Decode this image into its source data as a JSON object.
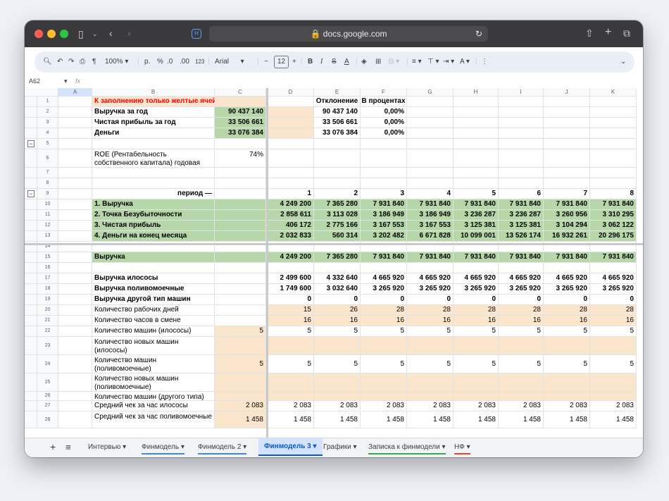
{
  "browser": {
    "url": "docs.google.com",
    "shield": "H"
  },
  "toolbar": {
    "zoom": "100%",
    "font": "Arial",
    "font_size": "12",
    "currency": "р.",
    "percent": "%",
    "dec_less": ".0",
    "dec_more": ".00",
    "number_format": "123"
  },
  "formula": {
    "cell_ref": "A62",
    "fx": "fx",
    "value": ""
  },
  "columns": [
    "A",
    "B",
    "C",
    "D",
    "E",
    "F",
    "G",
    "H",
    "I",
    "J",
    "K"
  ],
  "rows": [
    {
      "n": "1",
      "B": "К заполнению только желтые ячейки!",
      "E": "Отклонение",
      "F": "В процентах"
    },
    {
      "n": "2",
      "B": "Выручка за год",
      "C": "90 437 140",
      "E": "90 437 140",
      "F": "0,00%"
    },
    {
      "n": "3",
      "B": "Чистая прибыль за год",
      "C": "33 506 661",
      "E": "33 506 661",
      "F": "0,00%"
    },
    {
      "n": "4",
      "B": "Деньги",
      "C": "33 076 384",
      "E": "33 076 384",
      "F": "0,00%"
    },
    {
      "n": "5"
    },
    {
      "n": "6",
      "B": "ROE (Рентабельность собственного капитала) годовая",
      "C": "74%"
    },
    {
      "n": "7"
    },
    {
      "n": "8"
    },
    {
      "n": "9",
      "B": "период —",
      "D": "1",
      "E": "2",
      "F": "3",
      "G": "4",
      "H": "5",
      "I": "6",
      "J": "7",
      "K": "8"
    },
    {
      "n": "10",
      "B": "1. Выручка",
      "D": "4 249 200",
      "E": "7 365 280",
      "F": "7 931 840",
      "G": "7 931 840",
      "H": "7 931 840",
      "I": "7 931 840",
      "J": "7 931 840",
      "K": "7 931 840"
    },
    {
      "n": "11",
      "B": "2. Точка Безубыточности",
      "D": "2 858 611",
      "E": "3 113 028",
      "F": "3 186 949",
      "G": "3 186 949",
      "H": "3 236 287",
      "I": "3 236 287",
      "J": "3 260 956",
      "K": "3 310 295"
    },
    {
      "n": "12",
      "B": "3. Чистая прибыль",
      "D": "406 172",
      "E": "2 775 166",
      "F": "3 167 553",
      "G": "3 167 553",
      "H": "3 125 381",
      "I": "3 125 381",
      "J": "3 104 294",
      "K": "3 062 122"
    },
    {
      "n": "13",
      "B": "4. Деньги на конец месяца",
      "D": "2 032 833",
      "E": "560 314",
      "F": "3 202 482",
      "G": "6 671 828",
      "H": "10 099 001",
      "I": "13 526 174",
      "J": "16 932 261",
      "K": "20 296 175"
    },
    {
      "n": "14"
    },
    {
      "n": "15",
      "B": "Выручка",
      "D": "4 249 200",
      "E": "7 365 280",
      "F": "7 931 840",
      "G": "7 931 840",
      "H": "7 931 840",
      "I": "7 931 840",
      "J": "7 931 840",
      "K": "7 931 840"
    },
    {
      "n": "16"
    },
    {
      "n": "17",
      "B": "Выручка илососы",
      "D": "2 499 600",
      "E": "4 332 640",
      "F": "4 665 920",
      "G": "4 665 920",
      "H": "4 665 920",
      "I": "4 665 920",
      "J": "4 665 920",
      "K": "4 665 920"
    },
    {
      "n": "18",
      "B": "Выручка поливомоечные",
      "D": "1 749 600",
      "E": "3 032 640",
      "F": "3 265 920",
      "G": "3 265 920",
      "H": "3 265 920",
      "I": "3 265 920",
      "J": "3 265 920",
      "K": "3 265 920"
    },
    {
      "n": "19",
      "B": "Выручка другой тип машин",
      "D": "0",
      "E": "0",
      "F": "0",
      "G": "0",
      "H": "0",
      "I": "0",
      "J": "0",
      "K": "0"
    },
    {
      "n": "20",
      "B": "Количество рабочих дней",
      "D": "15",
      "E": "26",
      "F": "28",
      "G": "28",
      "H": "28",
      "I": "28",
      "J": "28",
      "K": "28"
    },
    {
      "n": "21",
      "B": "Количество часов в смене",
      "D": "16",
      "E": "16",
      "F": "16",
      "G": "16",
      "H": "16",
      "I": "16",
      "J": "16",
      "K": "16"
    },
    {
      "n": "22",
      "B": "Количество машин (илососы)",
      "C": "5",
      "D": "5",
      "E": "5",
      "F": "5",
      "G": "5",
      "H": "5",
      "I": "5",
      "J": "5",
      "K": "5"
    },
    {
      "n": "23",
      "B": "Количество новых машин (илососы)"
    },
    {
      "n": "24",
      "B": "Количество машин (поливомоечные)",
      "C": "5",
      "D": "5",
      "E": "5",
      "F": "5",
      "G": "5",
      "H": "5",
      "I": "5",
      "J": "5",
      "K": "5"
    },
    {
      "n": "25",
      "B": "Количество новых машин (поливомоечные)"
    },
    {
      "n": "26",
      "B": "Количество машин (другого типа)"
    },
    {
      "n": "27",
      "B": "Средний чек за час  илососы",
      "C": "2 083",
      "D": "2 083",
      "E": "2 083",
      "F": "2 083",
      "G": "2 083",
      "H": "2 083",
      "I": "2 083",
      "J": "2 083",
      "K": "2 083"
    },
    {
      "n": "28",
      "B": "Средний чек за час поливомоечные",
      "C": "1 458",
      "D": "1 458",
      "E": "1 458",
      "F": "1 458",
      "G": "1 458",
      "H": "1 458",
      "I": "1 458",
      "J": "1 458",
      "K": "1 458"
    }
  ],
  "sheet_tabs": [
    "Интервью",
    "Финмодель",
    "Финмодель 2",
    "Финмодель 3",
    "Графики",
    "Записка к финмодели",
    "НФ"
  ],
  "active_tab": "Финмодель 3",
  "colors": {
    "green": "#b6d7a8",
    "yellow": "#fce5cd",
    "red": "#ff0000",
    "active_tab": "#d3e3fd"
  }
}
